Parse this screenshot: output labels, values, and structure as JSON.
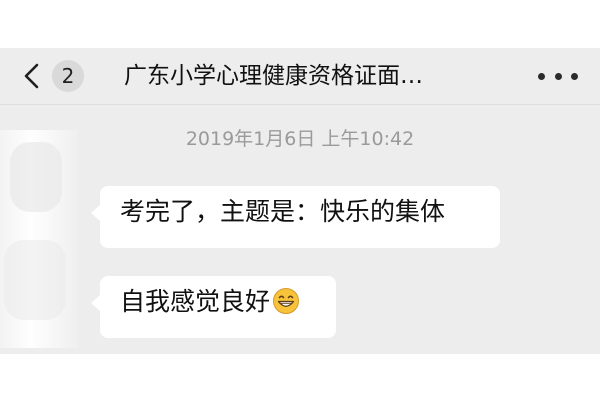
{
  "header": {
    "back_icon": "chevron-left-icon",
    "unread_count": "2",
    "title": "广东小学心理健康资格证面…",
    "more_icon": "more-dots-icon"
  },
  "conversation": {
    "timestamp": "2019年1月6日 上午10:42",
    "messages": [
      {
        "text": "考完了，主题是：快乐的集体"
      },
      {
        "text": "自我感觉良好",
        "emoji": "grinning-face-icon"
      }
    ]
  },
  "colors": {
    "chat_background": "#ededed",
    "bubble": "#ffffff",
    "timestamp_text": "#9a9a9a",
    "badge": "#d9d9d9"
  }
}
